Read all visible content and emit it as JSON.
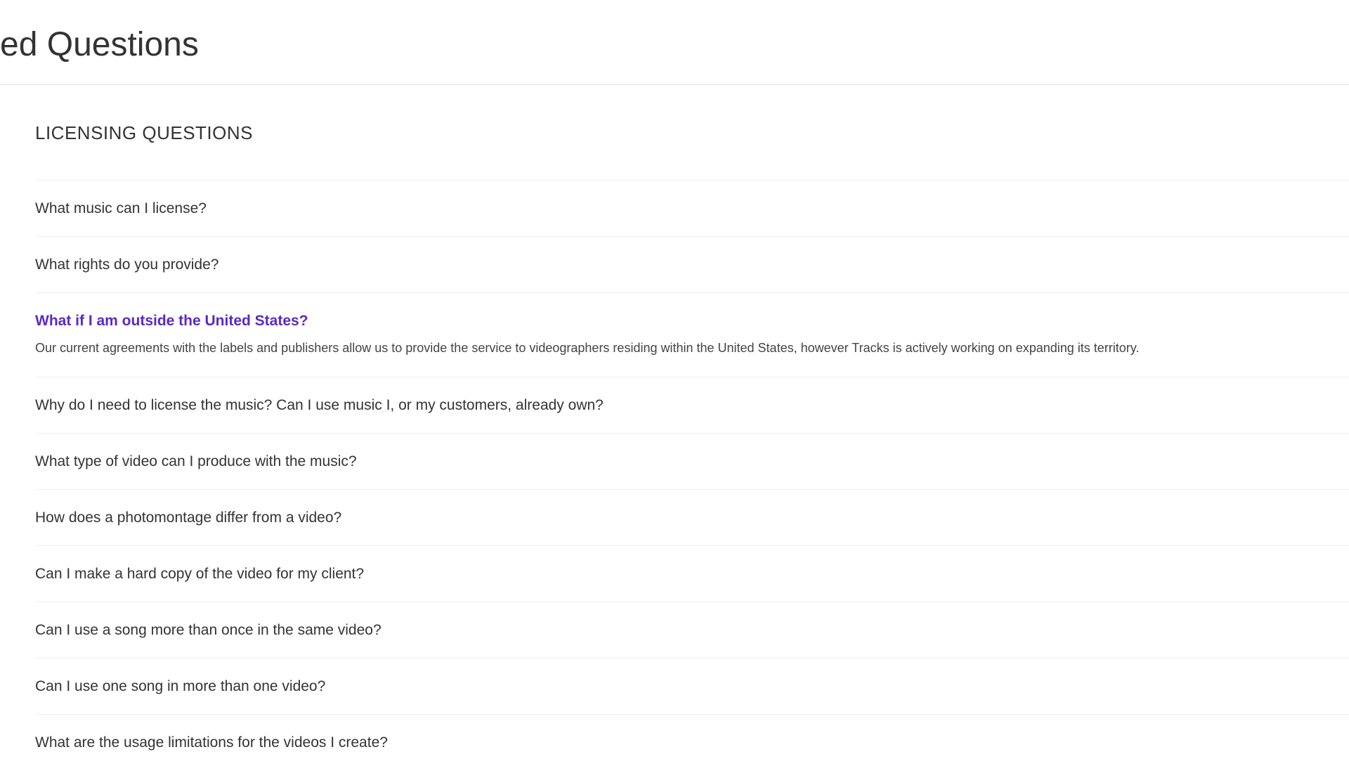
{
  "header": {
    "title": "ed Questions"
  },
  "section": {
    "title": "LICENSING QUESTIONS",
    "accent_color": "#5b28c7",
    "items": [
      {
        "question": "What music can I license?"
      },
      {
        "question": "What rights do you provide?"
      },
      {
        "question": "What if I am outside the United States?",
        "answer": "Our current agreements with the labels and publishers allow us to provide the service to videographers residing within the United States, however Tracks is actively working on expanding its territory.",
        "expanded": true
      },
      {
        "question": "Why do I need to license the music? Can I use music I, or my customers, already own?"
      },
      {
        "question": "What type of video can I produce with the music?"
      },
      {
        "question": "How does a photomontage differ from a video?"
      },
      {
        "question": "Can I make a hard copy of the video for my client?"
      },
      {
        "question": "Can I use a song more than once in the same video?"
      },
      {
        "question": "Can I use one song in more than one video?"
      },
      {
        "question": "What are the usage limitations for the videos I create?"
      }
    ]
  }
}
